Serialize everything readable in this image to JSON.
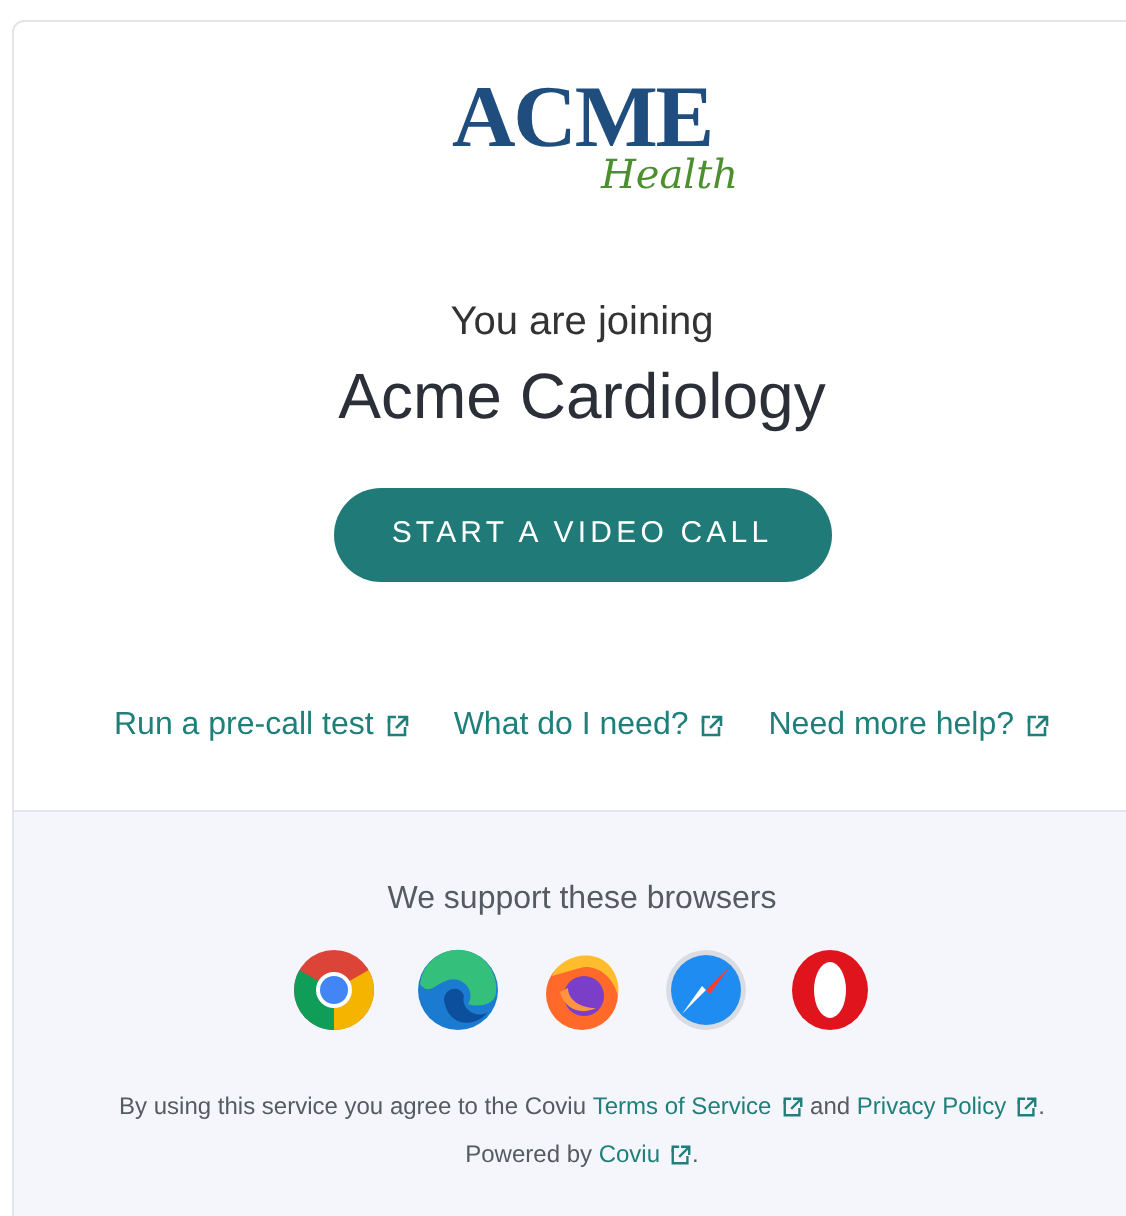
{
  "logo": {
    "word": "ACME",
    "subword": "Health"
  },
  "heading": {
    "intro": "You are joining",
    "clinic": "Acme Cardiology"
  },
  "start_button": "START A VIDEO CALL",
  "help_links": [
    {
      "text": "Run a pre-call test"
    },
    {
      "text": "What do I need?"
    },
    {
      "text": "Need more help?"
    }
  ],
  "browsers": {
    "title": "We support these browsers",
    "items": [
      {
        "kind": "chrome"
      },
      {
        "kind": "edge"
      },
      {
        "kind": "firefox"
      },
      {
        "kind": "safari"
      },
      {
        "kind": "opera"
      }
    ]
  },
  "legal": [
    [
      {
        "kind": "text",
        "text": "By using this service you agree to the Coviu "
      },
      {
        "kind": "link",
        "text": "Terms of Service"
      },
      {
        "kind": "text",
        "text": " and "
      },
      {
        "kind": "link",
        "text": "Privacy Policy"
      },
      {
        "kind": "text",
        "text": "."
      }
    ],
    [
      {
        "kind": "text",
        "text": "Powered by "
      },
      {
        "kind": "link",
        "text": "Coviu"
      },
      {
        "kind": "text",
        "text": "."
      }
    ]
  ]
}
